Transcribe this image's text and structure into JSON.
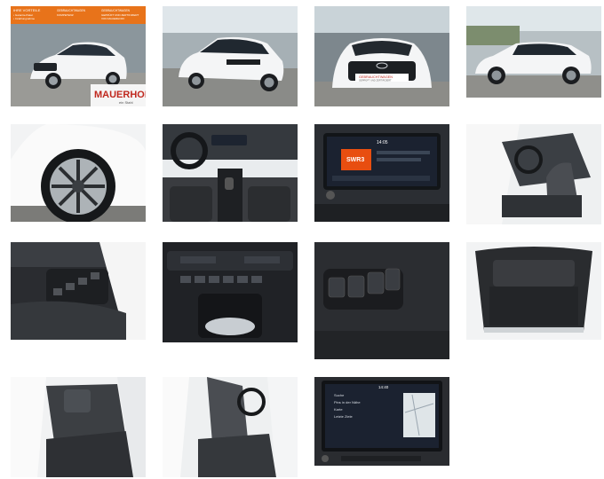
{
  "gallery": {
    "thumbs": [
      {
        "label": "Hyundai i20 front three-quarter at dealer",
        "overlay": {
          "banner_lines_left": [
            "IHRE VORTEILE",
            "• Garantie-Paket",
            "• Inzahlungnahme",
            "• Finanzierung"
          ],
          "banner_lines_mid": [
            "GEBRAUCHTWAGEN",
            "KOMPETENZ",
            "MAUERHOFF"
          ],
          "banner_lines_right": [
            "GEBRAUCHTWAGEN",
            "GEPRÜFT UND ZERTIFIZIERT",
            "VON MAUERHOFF"
          ],
          "brand": "MAUERHOFF",
          "brand_sub": "ein Stahl"
        }
      },
      {
        "label": "Rear three-quarter view"
      },
      {
        "label": "Front view with grille",
        "overlay": {
          "plate_text": "GEBRAUCHTWAGEN",
          "plate_sub": "GEPRÜFT UND ZERTIFIZIERT"
        }
      },
      {
        "label": "Side profile view"
      },
      {
        "label": "Alloy wheel close-up"
      },
      {
        "label": "Dashboard and cockpit"
      },
      {
        "label": "Infotainment radio screen",
        "overlay": {
          "station": "SWR3",
          "clock": "14:05"
        }
      },
      {
        "label": "Driver seat from open door"
      },
      {
        "label": "Door panel window switches"
      },
      {
        "label": "Center console climate controls"
      },
      {
        "label": "Light and mirror switch panel"
      },
      {
        "label": "Open trunk cargo area"
      },
      {
        "label": "Rear seats from open door"
      },
      {
        "label": "Front passenger seat view"
      },
      {
        "label": "Navigation screen",
        "overlay": {
          "clock": "14:40",
          "menu": [
            "Suche",
            "Pins in der Nähe",
            "Karte",
            "Letzte Ziele"
          ]
        }
      }
    ]
  },
  "colors": {
    "orange": "#e8731a",
    "mauerhoff_red": "#c0281e",
    "car_white": "#f4f5f6",
    "interior_dark": "#2a2c30",
    "screen_bg": "#1b2230"
  }
}
